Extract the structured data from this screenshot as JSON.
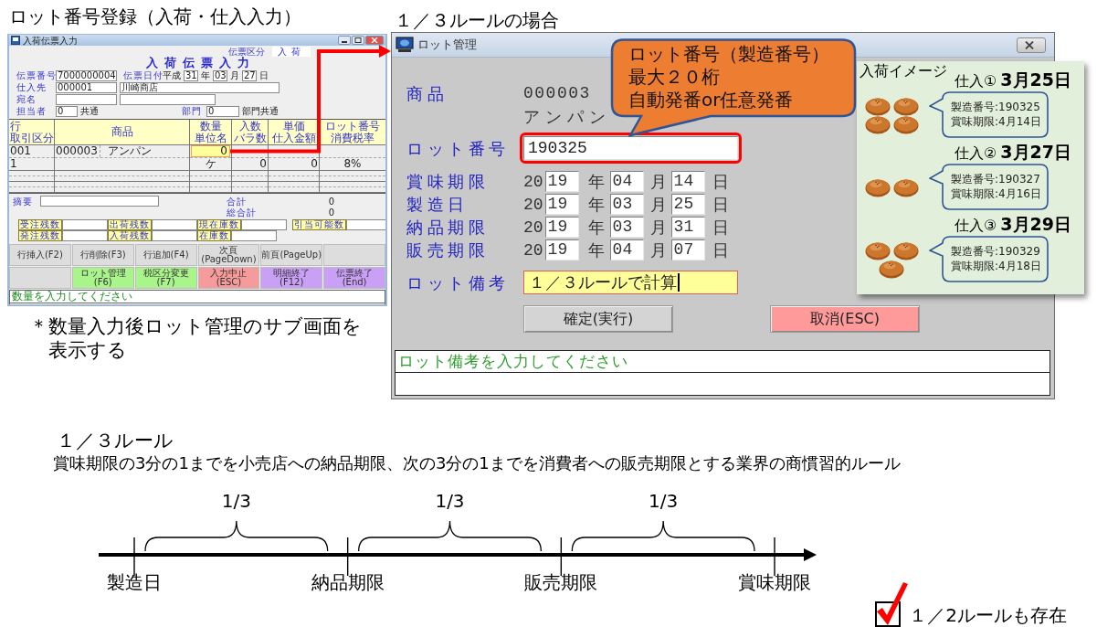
{
  "slide_title": "ロット番号登録（入荷・仕入入力）",
  "entry_window": {
    "title": "入荷伝票入力",
    "slip_type": {
      "label": "伝票区分",
      "value": "入荷"
    },
    "heading": "入荷伝票入力",
    "slip_no": {
      "label": "伝票番号",
      "value": "7000000004"
    },
    "slip_date": {
      "label": "伝票日付",
      "era": "平成",
      "year": "31",
      "year_unit": "年",
      "month": "03",
      "month_unit": "月",
      "day": "27",
      "day_unit": "日"
    },
    "supplier": {
      "label": "仕入先",
      "code": "000001",
      "name": "川崎商店"
    },
    "addressee": {
      "label": "宛名"
    },
    "staff": {
      "label": "担当者",
      "code": "0",
      "name": "共通"
    },
    "department": {
      "label": "部門",
      "code": "0",
      "name": "部門共通"
    },
    "table": {
      "columns": [
        {
          "top": "行",
          "bottom": "取引区分"
        },
        {
          "top": "商品"
        },
        {
          "top": "数量",
          "bottom": "単位名"
        },
        {
          "top": "入数",
          "bottom": "バラ数"
        },
        {
          "top": "単価",
          "bottom": "仕入金額"
        },
        {
          "top": "ロット番号",
          "bottom": "消費税率"
        }
      ],
      "rows": [
        {
          "line_no": "001",
          "deal_type": "1",
          "code": "000003",
          "name": "アンパン",
          "quantity": "0",
          "quantity_focused": true,
          "unit": "ケ",
          "loose_qty": "0",
          "amount": "0",
          "tax_rate": "8%"
        }
      ]
    },
    "memo": {
      "label": "摘要"
    },
    "total": {
      "label": "合計",
      "value": "0"
    },
    "grand_total": {
      "label": "総合計",
      "value": "0"
    },
    "stock_rows": [
      [
        {
          "label": "受注残数"
        },
        {
          "label": "出荷残数"
        },
        {
          "label": "現在庫数"
        },
        {
          "label": "引当可能数"
        }
      ],
      [
        {
          "label": "発注残数"
        },
        {
          "label": "入荷残数"
        },
        {
          "label": "在庫数"
        }
      ]
    ],
    "function_keys": [
      [
        {
          "kind": "key",
          "label": "行挿入(F2)",
          "color": "#dddddd"
        },
        {
          "kind": "key",
          "label": "行削除(F3)",
          "color": "#dddddd"
        },
        {
          "kind": "key",
          "label": "行追加(F4)",
          "color": "#dddddd"
        },
        {
          "kind": "key",
          "label": "次頁(PageDown)",
          "color": "#dddddd"
        },
        {
          "kind": "key",
          "label": "前頁(PageUp)",
          "color": "#dddddd"
        },
        {
          "kind": "blank",
          "color": "#dddddd"
        }
      ],
      [
        {
          "kind": "blank",
          "color": "#dddddd"
        },
        {
          "kind": "key",
          "label": "ロット管理(F6)",
          "color": "#a9f58c"
        },
        {
          "kind": "key",
          "label": "税区分変更(F7)",
          "color": "#a9f58c"
        },
        {
          "kind": "key",
          "label": "入力中止(ESC)",
          "color": "#f59b9b"
        },
        {
          "kind": "key",
          "label": "明細終了(F12)",
          "color": "#c9a0f5"
        },
        {
          "kind": "key",
          "label": "伝票終了(End)",
          "color": "#c9a0f5"
        }
      ]
    ],
    "status_message": "数量を入力してください"
  },
  "caption": "＊数量入力後ロット管理のサブ画面を表示する",
  "lot_section_title": "１／３ルールの場合",
  "lot_window": {
    "title": "ロット管理",
    "product": {
      "label": "商品",
      "code": "000003",
      "name": "アンパン"
    },
    "lot_number": {
      "label": "ロット番号",
      "value": "190325",
      "highlighted": true
    },
    "dates": [
      {
        "label": "賞味期限",
        "century": "20",
        "year": "19",
        "year_unit": "年",
        "month": "04",
        "month_unit": "月",
        "day": "14",
        "day_unit": "日"
      },
      {
        "label": "製造日",
        "century": "20",
        "year": "19",
        "year_unit": "年",
        "month": "03",
        "month_unit": "月",
        "day": "25",
        "day_unit": "日"
      },
      {
        "label": "納品期限",
        "century": "20",
        "year": "19",
        "year_unit": "年",
        "month": "03",
        "month_unit": "月",
        "day": "31",
        "day_unit": "日"
      },
      {
        "label": "販売期限",
        "century": "20",
        "year": "19",
        "year_unit": "年",
        "month": "04",
        "month_unit": "月",
        "day": "07",
        "day_unit": "日"
      }
    ],
    "remarks": {
      "label": "ロット備考",
      "value": "１／３ルールで計算",
      "focused": true
    },
    "buttons": [
      {
        "kind": "confirm",
        "label": "確定(実行)",
        "color": "#d4d4d4"
      },
      {
        "kind": "cancel",
        "label": "取消(ESC)",
        "color": "#ff9a9a"
      }
    ],
    "status_message": "ロット備考を入力してください"
  },
  "callout": {
    "lines": [
      "ロット番号（製造番号）",
      "最大２０桁",
      "自動発番or任意発番"
    ]
  },
  "arrival_image": {
    "title": "入荷イメージ",
    "purchases": [
      {
        "label": "仕入①",
        "date": "3月25日",
        "buns": [
          {
            "kind": "bun"
          },
          {
            "kind": "bun"
          },
          {
            "kind": "bun"
          },
          {
            "kind": "bun"
          }
        ],
        "lot": "製造番号:190325",
        "expiry": "賞味期限:4月14日"
      },
      {
        "label": "仕入②",
        "date": "3月27日",
        "buns": [
          {
            "kind": "bun"
          },
          {
            "kind": "bun"
          }
        ],
        "lot": "製造番号:190327",
        "expiry": "賞味期限:4月16日"
      },
      {
        "label": "仕入③",
        "date": "3月29日",
        "buns": [
          {
            "kind": "bun"
          },
          {
            "kind": "bun"
          },
          {
            "kind": "bun"
          }
        ],
        "lot": "製造番号:190329",
        "expiry": "賞味期限:4月18日"
      }
    ]
  },
  "rule": {
    "title": "１／３ルール",
    "description": "賞味期限の3分の1までを小売店への納品期限、次の3分の1までを消費者への販売期限とする業界の商慣習的ルール",
    "timeline": {
      "segments": [
        "1/3",
        "1/3",
        "1/3"
      ],
      "points": [
        "製造日",
        "納品期限",
        "販売期限",
        "賞味期限"
      ]
    }
  },
  "note": {
    "checked": true,
    "text": "１／2ルールも存在"
  }
}
